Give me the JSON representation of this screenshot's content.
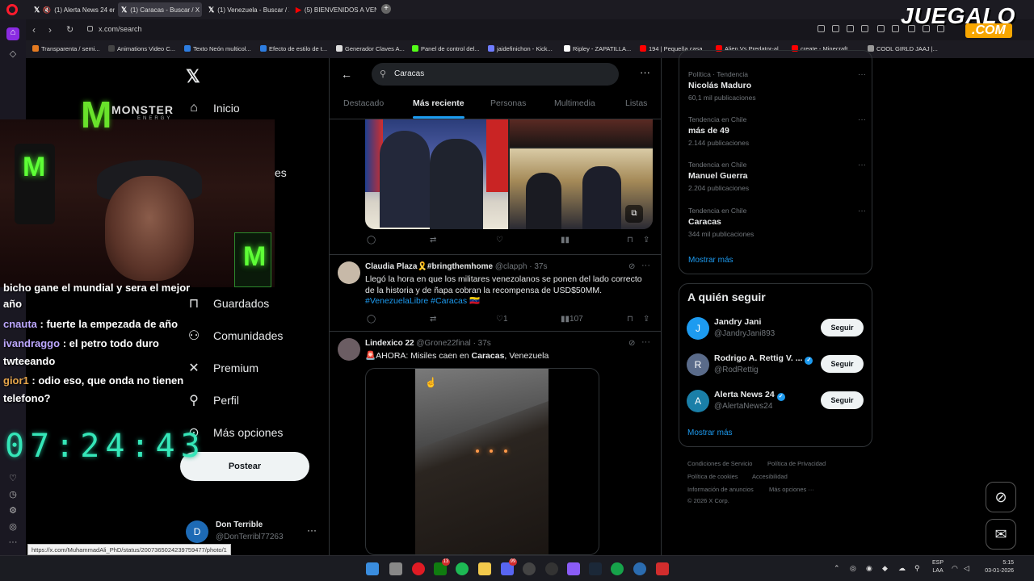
{
  "browser": {
    "tabs": [
      {
        "label": "(1) Alerta News 24 en",
        "icon": "x-logo"
      },
      {
        "label": "(1) Caracas - Buscar / X",
        "icon": "x-logo"
      },
      {
        "label": "(1) Venezuela - Buscar / X",
        "icon": "x-logo"
      },
      {
        "label": "(5) BIENVENIDOS A VENE",
        "icon": "youtube-logo"
      }
    ],
    "url": "x.com/search",
    "bookmarks": [
      "Transparenta / semi...",
      "Animations Video C...",
      "Texto Neón multicol...",
      "Efecto de estilo de t...",
      "Generador Claves A...",
      "Panel de control del...",
      "jaidefinichon - Kick...",
      "Ripley - ZAPATILLA...",
      "194 | Pequeña casa...",
      "Alien Vs Predator-al...",
      "create - Minecraft...",
      "COOL GIRLD JAAJ |..."
    ],
    "status_url": "https://x.com/MuhammadAli_PhD/status/2007365024239759477/photo/1",
    "overlay_logo": {
      "text": "JUEGALO",
      "sub": ".COM"
    }
  },
  "stream_overlay": {
    "monster": {
      "brand": "MONSTER",
      "sub": "ENERGY"
    },
    "chat": [
      {
        "user": "",
        "text": "bicho gane el mundial y sera el mejor"
      },
      {
        "user": "",
        "text": "año"
      },
      {
        "user": "cnauta",
        "text": ": fuerte la empezada de año"
      },
      {
        "user": "ivandraggo",
        "text": ": el petro todo duro"
      },
      {
        "user": "",
        "text": "twteeando"
      },
      {
        "user": "gior1",
        "text": ": odio eso, que onda no tienen"
      },
      {
        "user": "",
        "text": "telefono?"
      }
    ],
    "timer": "07:24:43"
  },
  "x_nav": {
    "items": [
      {
        "label": "Inicio",
        "icon": "home-icon"
      },
      {
        "label": "es",
        "icon": ""
      },
      {
        "label": "Guardados",
        "icon": "bookmark-icon"
      },
      {
        "label": "Comunidades",
        "icon": "communities-icon"
      },
      {
        "label": "Premium",
        "icon": "x-icon"
      },
      {
        "label": "Perfil",
        "icon": "person-icon"
      },
      {
        "label": "Más opciones",
        "icon": "more-circle-icon"
      }
    ],
    "post_button": "Postear",
    "account": {
      "name": "Don Terrible",
      "handle": "@DonTerribl77263",
      "initial": "D"
    }
  },
  "search": {
    "query": "Caracas",
    "tabs": [
      "Destacado",
      "Más reciente",
      "Personas",
      "Multimedia",
      "Listas"
    ],
    "active_tab": "Más reciente"
  },
  "posts": [
    {
      "name": "Claudia Plaza🎗️#bringthemhome",
      "handle": "@clapph",
      "time": "· 37s",
      "text_a": "Llegó la hora en que los militares venezolanos se ponen del lado correcto de la historia y de ñapa cobran la recompensa de USD$50MM.",
      "tag1": "#VenezuelaLibre",
      "tag2": "#Caracas",
      "flag": "🇻🇪",
      "likes": "1",
      "views": "107"
    },
    {
      "name": "Lindexico 22",
      "handle": "@Grone22final",
      "time": "· 37s",
      "text_a": "🚨AHORA: Misiles caen en ",
      "bold": "Caracas",
      "text_b": ", Venezuela"
    }
  ],
  "trends": [
    {
      "category": "Política · Tendencia",
      "name": "Nicolás Maduro",
      "count": "60,1 mil publicaciones"
    },
    {
      "category": "Tendencia en Chile",
      "name": "más de 49",
      "count": "2.144 publicaciones"
    },
    {
      "category": "Tendencia en Chile",
      "name": "Manuel Guerra",
      "count": "2.204 publicaciones"
    },
    {
      "category": "Tendencia en Chile",
      "name": "Caracas",
      "count": "344 mil publicaciones"
    }
  ],
  "show_more": "Mostrar más",
  "who_to_follow": {
    "title": "A quién seguir",
    "users": [
      {
        "name": "Jandry Jani",
        "handle": "@JandryJani893",
        "initial": "J",
        "verified": false,
        "color": "#1d9bf0"
      },
      {
        "name": "Rodrigo A. Rettig V. ...",
        "handle": "@RodRettig",
        "initial": "R",
        "verified": true,
        "color": "#5a6b8a"
      },
      {
        "name": "Alerta News 24",
        "handle": "@AlertaNews24",
        "initial": "A",
        "verified": true,
        "color": "#1a7fa8"
      }
    ],
    "follow_label": "Seguir"
  },
  "footer": {
    "links": [
      "Condiciones de Servicio",
      "Política de Privacidad",
      "Política de cookies",
      "Accesibilidad",
      "Información de anuncios",
      "Más opciones ···"
    ],
    "copyright": "© 2026 X Corp."
  },
  "taskbar": {
    "lang": "ESP",
    "lang2": "LAA",
    "time": "5:15",
    "date": "03-01-2026",
    "badges": [
      "13",
      "99"
    ]
  },
  "colors": {
    "accent": "#1d9bf0",
    "background": "#000000",
    "border": "#2f3336",
    "muted": "#71767b"
  }
}
